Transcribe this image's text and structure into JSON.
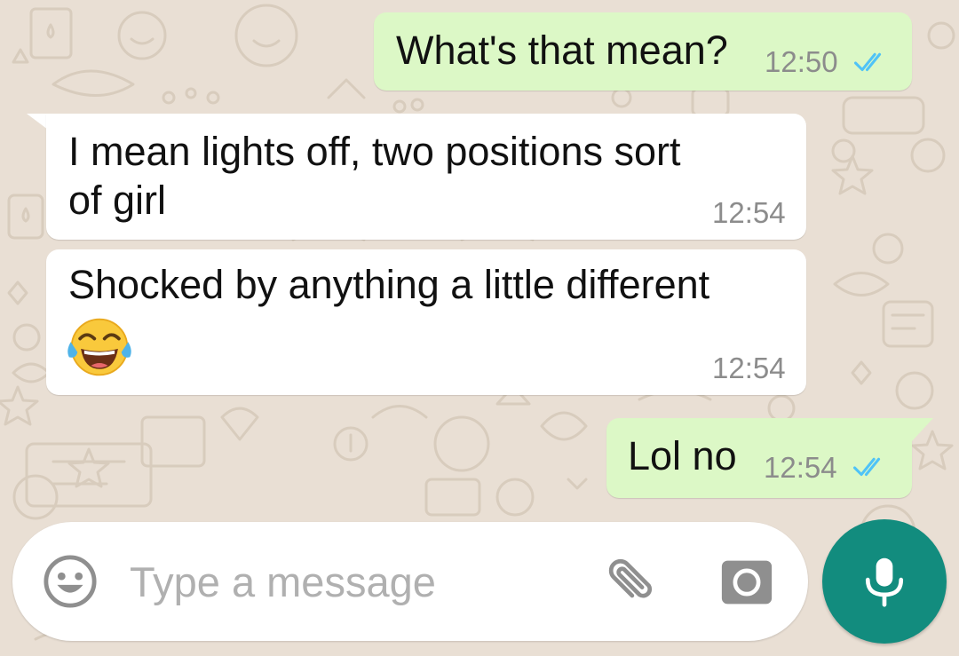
{
  "conversation": {
    "messages": [
      {
        "direction": "outgoing",
        "text": "What's that mean?",
        "time": "12:50",
        "status": "read"
      },
      {
        "direction": "incoming",
        "text_lines": [
          "I mean lights off, two positions sort",
          "of girl"
        ],
        "time": "12:54"
      },
      {
        "direction": "incoming",
        "text": "Shocked by anything a little different",
        "emoji": "face-with-tears-of-joy",
        "time": "12:54"
      },
      {
        "direction": "outgoing",
        "text": "Lol no",
        "time": "12:54",
        "status": "read"
      }
    ]
  },
  "composer": {
    "placeholder": "Type a message",
    "icons": [
      "emoji-icon",
      "attach-icon",
      "camera-icon",
      "mic-icon"
    ]
  },
  "colors": {
    "background": "#e9dfd4",
    "outgoing_bubble": "#dcf8c6",
    "incoming_bubble": "#ffffff",
    "read_ticks": "#4fc3f7",
    "mic_button": "#128c7e",
    "timestamp": "#8c8c8c"
  }
}
